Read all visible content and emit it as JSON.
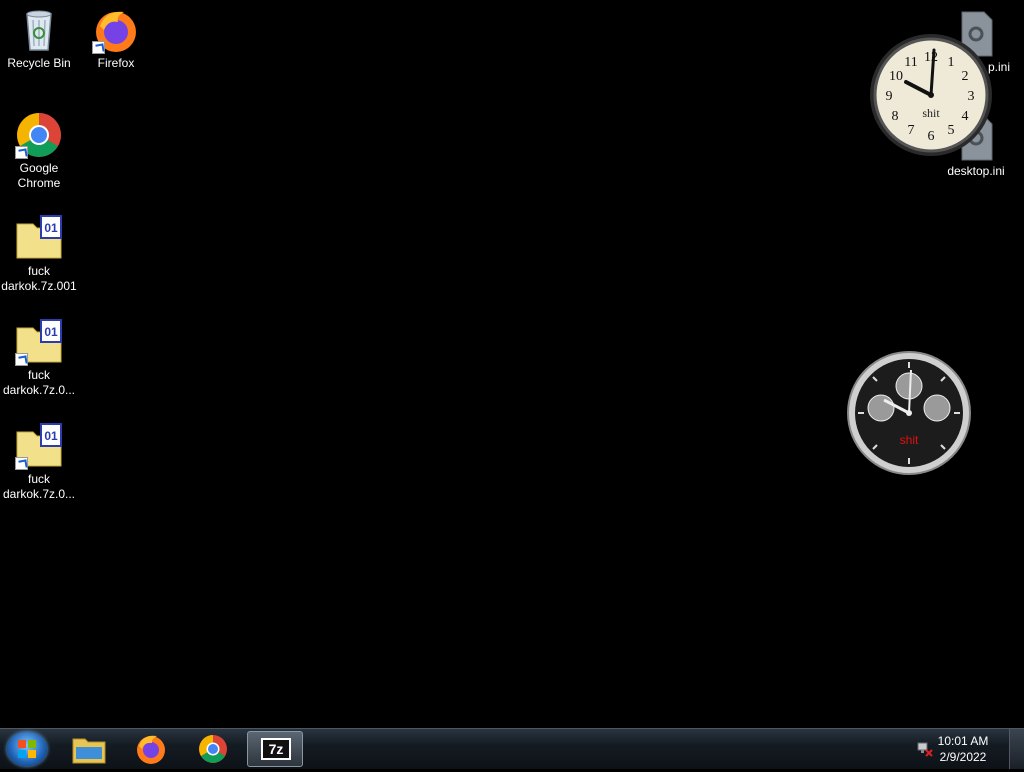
{
  "desktop_icons": {
    "recycle_bin": "Recycle Bin",
    "firefox": "Firefox",
    "chrome": "Google Chrome",
    "archive1": "fuck darkok.7z.001",
    "archive2": "fuck darkok.7z.0...",
    "archive3": "fuck darkok.7z.0...",
    "desktop_ini_top": "p.ini",
    "desktop_ini": "desktop.ini"
  },
  "gadgets": {
    "analog_clock_label": "shit",
    "analog_clock_numbers": [
      "12",
      "1",
      "2",
      "3",
      "4",
      "5",
      "6",
      "7",
      "8",
      "9",
      "10",
      "11"
    ],
    "chrono_clock_label": "shit",
    "chrono_label_color": "#e01010"
  },
  "taskbar": {
    "time": "10:01 AM",
    "date": "2/9/2022",
    "seven_zip_label": "7z"
  },
  "colors": {
    "background": "#000000",
    "taskbar": "#141b22",
    "accent": "#1e62b5"
  }
}
